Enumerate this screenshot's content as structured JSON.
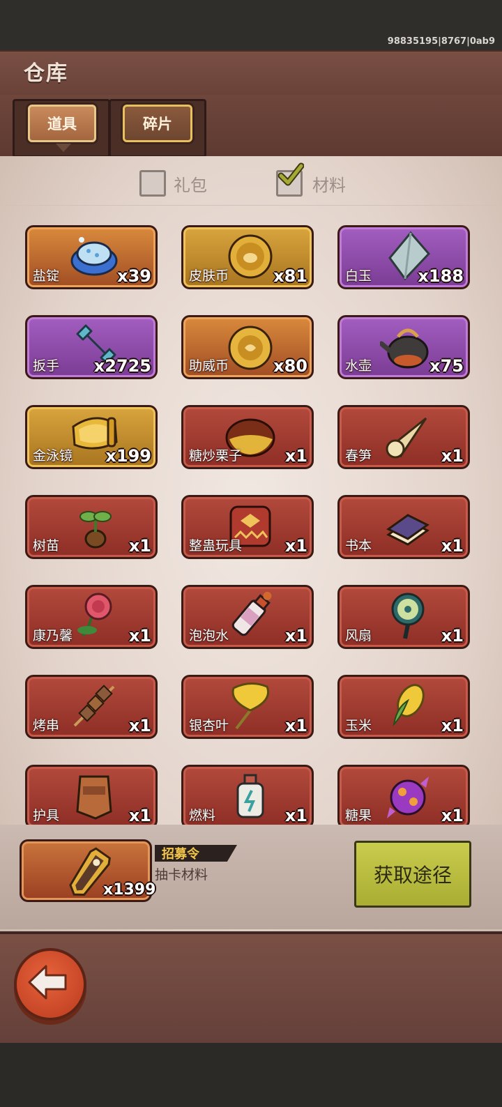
{
  "status": {
    "build_id": "98835195|8767|0ab9"
  },
  "header": {
    "title": "仓库"
  },
  "tabs": [
    {
      "label": "道具",
      "active": true
    },
    {
      "label": "碎片",
      "active": false
    }
  ],
  "filters": [
    {
      "label": "礼包",
      "checked": false
    },
    {
      "label": "材料",
      "checked": true
    }
  ],
  "items": [
    {
      "name": "盐锭",
      "count": "x39",
      "rarity": "orange",
      "icon": "salt-ingot-icon"
    },
    {
      "name": "皮肤币",
      "count": "x81",
      "rarity": "gold",
      "icon": "skin-coin-icon"
    },
    {
      "name": "白玉",
      "count": "x188",
      "rarity": "purple",
      "icon": "white-jade-icon"
    },
    {
      "name": "扳手",
      "count": "x2725",
      "rarity": "purple",
      "icon": "wrench-icon"
    },
    {
      "name": "助威币",
      "count": "x80",
      "rarity": "orange",
      "icon": "cheer-coin-icon"
    },
    {
      "name": "水壶",
      "count": "x75",
      "rarity": "purple",
      "icon": "kettle-icon"
    },
    {
      "name": "金泳镜",
      "count": "x199",
      "rarity": "gold",
      "icon": "golden-goggles-icon"
    },
    {
      "name": "糖炒栗子",
      "count": "x1",
      "rarity": "red",
      "icon": "chestnut-icon"
    },
    {
      "name": "春笋",
      "count": "x1",
      "rarity": "red",
      "icon": "bamboo-shoot-icon"
    },
    {
      "name": "树苗",
      "count": "x1",
      "rarity": "red",
      "icon": "sapling-icon"
    },
    {
      "name": "整蛊玩具",
      "count": "x1",
      "rarity": "red",
      "icon": "prank-toy-icon"
    },
    {
      "name": "书本",
      "count": "x1",
      "rarity": "red",
      "icon": "book-icon"
    },
    {
      "name": "康乃馨",
      "count": "x1",
      "rarity": "red",
      "icon": "carnation-icon"
    },
    {
      "name": "泡泡水",
      "count": "x1",
      "rarity": "red",
      "icon": "bubble-water-icon"
    },
    {
      "name": "风扇",
      "count": "x1",
      "rarity": "red",
      "icon": "fan-icon"
    },
    {
      "name": "烤串",
      "count": "x1",
      "rarity": "red",
      "icon": "skewer-icon"
    },
    {
      "name": "银杏叶",
      "count": "x1",
      "rarity": "red",
      "icon": "ginkgo-leaf-icon"
    },
    {
      "name": "玉米",
      "count": "x1",
      "rarity": "red",
      "icon": "corn-icon"
    },
    {
      "name": "护具",
      "count": "x1",
      "rarity": "red",
      "icon": "protective-gear-icon"
    },
    {
      "name": "燃料",
      "count": "x1",
      "rarity": "red",
      "icon": "fuel-icon"
    },
    {
      "name": "糖果",
      "count": "x1",
      "rarity": "red",
      "icon": "candy-icon"
    }
  ],
  "detail": {
    "name": "招募令",
    "description": "抽卡材料",
    "count": "x1399",
    "icon": "recruit-token-icon",
    "source_button": "获取途径"
  },
  "colors": {
    "accent": "#c9cc4d",
    "panel": "#e9ddd5",
    "wood": "#6e463c"
  }
}
